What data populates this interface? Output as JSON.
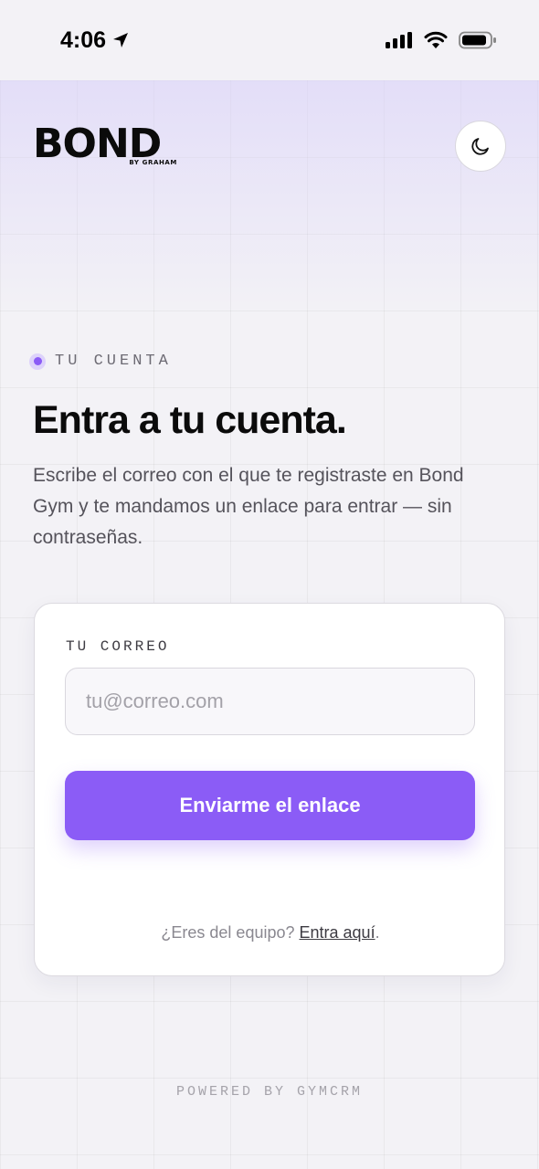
{
  "status_bar": {
    "time": "4:06",
    "icons": [
      "location-arrow-icon",
      "cellular-signal-icon",
      "wifi-icon",
      "battery-icon"
    ]
  },
  "header": {
    "logo_text": "BOND",
    "logo_sub": "BY GRAHAM",
    "theme_toggle_icon": "moon-icon"
  },
  "hero": {
    "eyebrow": "TU CUENTA",
    "title": "Entra a tu cuenta.",
    "subtitle": "Escribe el correo con el que te registraste en Bond Gym y te mandamos un enlace para entrar — sin contraseñas."
  },
  "form": {
    "email_label": "TU CORREO",
    "email_value": "",
    "email_placeholder": "tu@correo.com",
    "submit_label": "Enviarme el enlace",
    "team_prompt": "¿Eres del equipo?",
    "team_link": "Entra aquí",
    "team_suffix": "."
  },
  "footer": {
    "text": "POWERED BY GYMCRM"
  },
  "colors": {
    "accent": "#8b5cf6",
    "background": "#f3f2f6",
    "card": "#ffffff",
    "text": "#0b0b0b"
  }
}
